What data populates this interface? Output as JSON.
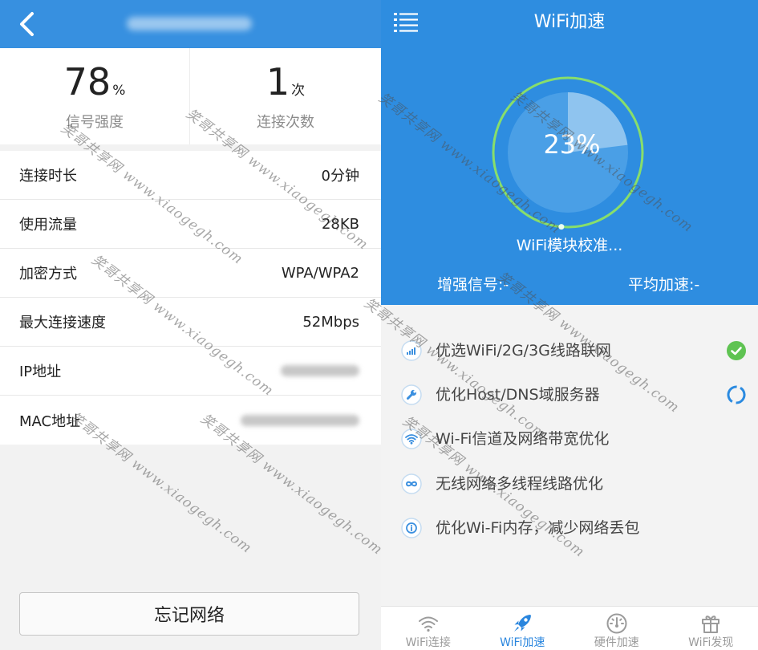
{
  "colors": {
    "primary_blue": "#2e8de0",
    "header_blue": "#3790e0",
    "ring_green": "#88de6b",
    "pie_fill": "#4a9fe6",
    "pie_slice": "#8fc4ef",
    "check_green": "#5fc352",
    "active_tab": "#2a86de"
  },
  "watermark": "笑哥共享网 www.xiaogegh.com",
  "left": {
    "header": {
      "back_icon": "chevron-left-icon"
    },
    "stats": [
      {
        "value": "78",
        "unit": "%",
        "label": "信号强度"
      },
      {
        "value": "1",
        "unit": "次",
        "label": "连接次数"
      }
    ],
    "details": [
      {
        "label": "连接时长",
        "value": "0分钟"
      },
      {
        "label": "使用流量",
        "value": "28KB"
      },
      {
        "label": "加密方式",
        "value": "WPA/WPA2"
      },
      {
        "label": "最大连接速度",
        "value": "52Mbps"
      },
      {
        "label": "IP地址"
      },
      {
        "label": "MAC地址"
      }
    ],
    "forget_button": "忘记网络"
  },
  "right": {
    "header": {
      "title": "WiFi加速",
      "menu_icon": "list-menu-icon"
    },
    "gauge": {
      "percent": 23,
      "percent_text": "23%",
      "status": "WiFi模块校准..."
    },
    "summary": {
      "signal": "增强信号:-",
      "speed": "平均加速:-"
    },
    "tasks": [
      {
        "label": "优选WiFi/2G/3G线路联网",
        "icon": "signal-bars-icon",
        "status_icon": "check-circle-icon"
      },
      {
        "label": "优化Host/DNS域服务器",
        "icon": "wrench-icon",
        "status_icon": "spinner-icon"
      },
      {
        "label": "Wi-Fi信道及网络带宽优化",
        "icon": "wifi-icon"
      },
      {
        "label": "无线网络多线程线路优化",
        "icon": "infinity-link-icon"
      },
      {
        "label": "优化Wi-Fi内存，减少网络丢包",
        "icon": "info-icon"
      }
    ],
    "tabs": [
      {
        "label": "WiFi连接",
        "icon": "wifi-icon",
        "active": false
      },
      {
        "label": "WiFi加速",
        "icon": "rocket-icon",
        "active": true
      },
      {
        "label": "硬件加速",
        "icon": "speedometer-icon",
        "active": false
      },
      {
        "label": "WiFi发现",
        "icon": "gift-icon",
        "active": false
      }
    ]
  }
}
